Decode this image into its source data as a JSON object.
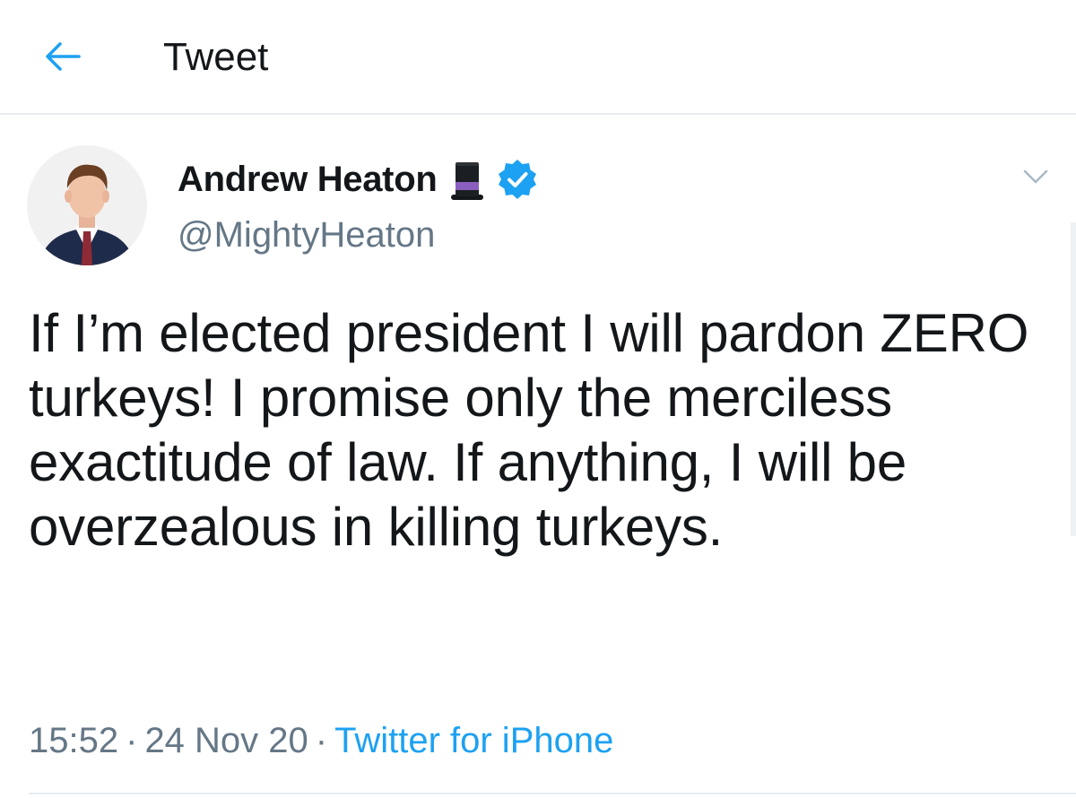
{
  "header": {
    "back_icon": "arrow-left-icon",
    "title": "Tweet"
  },
  "tweet": {
    "author": {
      "display_name": "Andrew Heaton",
      "emoji_icon": "top-hat-icon",
      "verified_icon": "verified-badge-icon",
      "handle": "@MightyHeaton"
    },
    "menu_icon": "chevron-down-icon",
    "text": "If I’m elected president I will pardon ZERO turkeys! I promise only the merciless exactitude of law. If anything, I will be overzealous in killing turkeys.",
    "time": "15:52",
    "date": "24 Nov 20",
    "separator": "·",
    "source": "Twitter for iPhone"
  },
  "colors": {
    "accent": "#1da1f2",
    "text": "#14171a",
    "secondary": "#657786",
    "divider": "#e6ecf0",
    "hat_band": "#8b5fbf"
  }
}
